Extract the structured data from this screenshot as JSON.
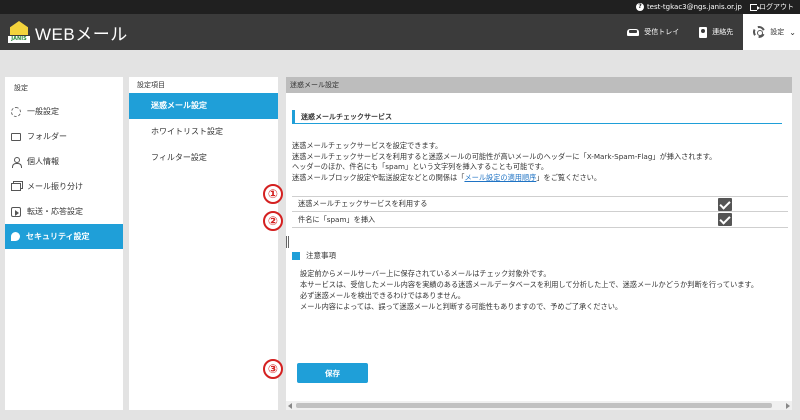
{
  "topbar": {
    "email": "test-tgkac3@ngs.janis.or.jp",
    "logout": "ログアウト"
  },
  "header": {
    "logo_tag": "JANIS",
    "title": "WEBメール",
    "nav": [
      {
        "label": "受信トレイ",
        "icon": "inbox-icon"
      },
      {
        "label": "連絡先",
        "icon": "contacts-icon"
      },
      {
        "label": "設定",
        "icon": "gear-icon"
      }
    ]
  },
  "sidebar": {
    "heading": "設定",
    "items": [
      {
        "label": "一般設定",
        "icon": "gear-icon"
      },
      {
        "label": "フォルダー",
        "icon": "folder-icon"
      },
      {
        "label": "個人情報",
        "icon": "person-icon"
      },
      {
        "label": "メール振り分け",
        "icon": "folders-icon"
      },
      {
        "label": "転送・応答設定",
        "icon": "forward-icon"
      },
      {
        "label": "セキュリティ設定",
        "icon": "shield-icon",
        "active": true
      }
    ]
  },
  "submenu": {
    "heading": "設定項目",
    "items": [
      {
        "label": "迷惑メール設定",
        "active": true
      },
      {
        "label": "ホワイトリスト設定"
      },
      {
        "label": "フィルター設定"
      }
    ]
  },
  "main": {
    "breadcrumb": "迷惑メール設定",
    "section_title": "迷惑メールチェックサービス",
    "desc_lines": [
      "迷惑メールチェックサービスを設定できます。",
      "迷惑メールチェックサービスを利用すると迷惑メールの可能性が高いメールのヘッダーに「X-Mark-Spam-Flag」が挿入されます。",
      "ヘッダーのほか、件名にも「spam」という文字列を挿入することも可能です。"
    ],
    "desc_last_pre": "迷惑メールブロック設定や転送設定などとの関係は「",
    "desc_link": "メール設定の適用順序",
    "desc_last_post": "」をご覧ください。",
    "option_use": "迷惑メールチェックサービスを利用する",
    "option_subject": "件名に「spam」を挿入",
    "notes_title": "注意事項",
    "notes": [
      "設定前からメールサーバー上に保存されているメールはチェック対象外です。",
      "本サービスは、受信したメール内容を実績のある迷惑メールデータベースを利用して分析した上で、迷惑メールかどうか判断を行っています。",
      "必ず迷惑メールを検出できるわけではありません。",
      "メール内容によっては、誤って迷惑メールと判断する可能性もありますので、予めご了承ください。"
    ],
    "save_label": "保存"
  },
  "markers": [
    "①",
    "②",
    "③"
  ]
}
